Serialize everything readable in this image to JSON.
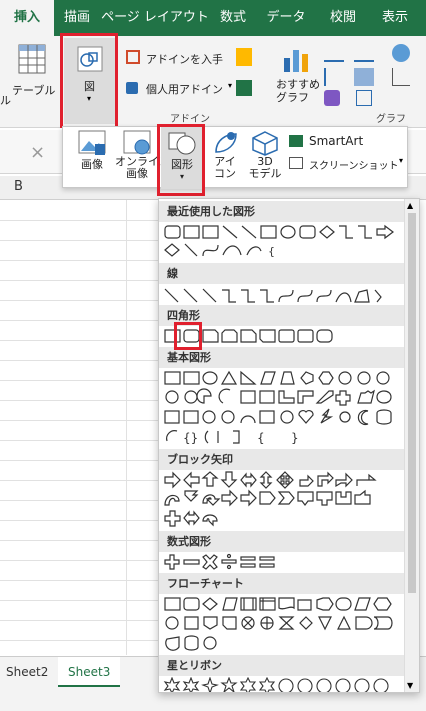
{
  "tabs": [
    "挿入",
    "描画",
    "ページ レイアウト",
    "数式",
    "データ",
    "校閲",
    "表示"
  ],
  "ribbon": {
    "table_label": "テーブル",
    "table_sub": "ル",
    "illustrations_label": "図",
    "addin_get": "アドインを入手",
    "addin_personal": "個人用アドイン",
    "addin_group": "アドイン",
    "recommended_chart": "おすすめ\nグラフ",
    "chart_group": "グラフ"
  },
  "illustrations": {
    "picture": "画像",
    "online_picture": "オンライン\n画像",
    "shapes": "図形",
    "icons": "アイ\nコン",
    "models_3d": "3D\nモデル",
    "smartart": "SmartArt",
    "screenshot": "スクリーンショット"
  },
  "formula": {
    "cancel_symbol": "×",
    "col_b": "B"
  },
  "shapes_panel": {
    "sections": [
      "最近使用した図形",
      "線",
      "四角形",
      "基本図形",
      "ブロック矢印",
      "数式図形",
      "フローチャート",
      "星とリボン"
    ]
  },
  "sheet_tabs": [
    "Sheet2",
    "Sheet3"
  ],
  "colors": {
    "excel_green": "#217346",
    "highlight": "#e0202e"
  }
}
